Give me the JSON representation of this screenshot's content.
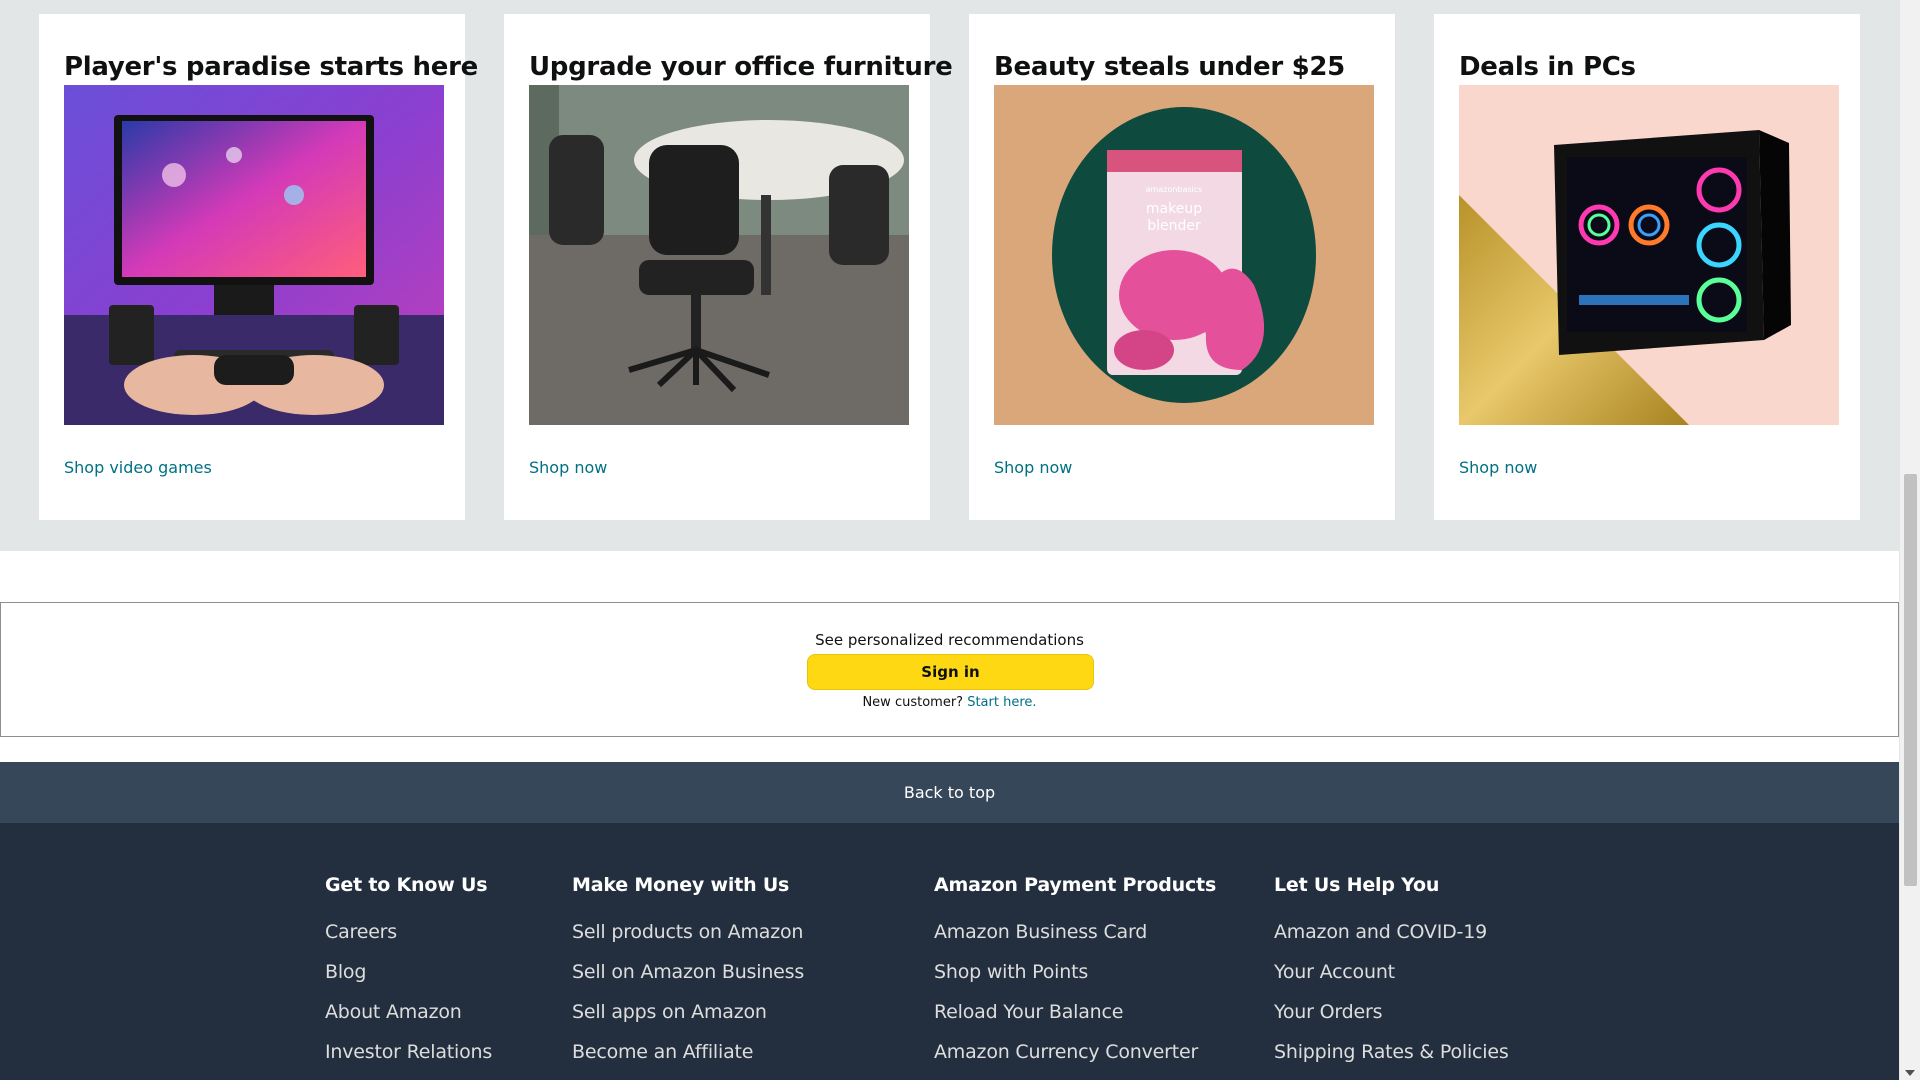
{
  "cards": [
    {
      "title": "Player's paradise starts here",
      "link": "Shop video games",
      "image": "gaming-setup-image"
    },
    {
      "title": "Upgrade your office furniture",
      "link": "Shop now",
      "image": "office-chair-image"
    },
    {
      "title": "Beauty steals under $25",
      "link": "Shop now",
      "image": "makeup-blender-image",
      "product_text": [
        "amazonbasics",
        "makeup",
        "blender"
      ]
    },
    {
      "title": "Deals in PCs",
      "link": "Shop now",
      "image": "gaming-pc-image"
    }
  ],
  "signin": {
    "prompt": "See personalized recommendations",
    "button": "Sign in",
    "new_customer": "New customer?",
    "start_here": "Start here."
  },
  "back_to_top": "Back to top",
  "footer": {
    "columns": [
      {
        "heading": "Get to Know Us",
        "links": [
          "Careers",
          "Blog",
          "About Amazon",
          "Investor Relations"
        ]
      },
      {
        "heading": "Make Money with Us",
        "links": [
          "Sell products on Amazon",
          "Sell on Amazon Business",
          "Sell apps on Amazon",
          "Become an Affiliate"
        ]
      },
      {
        "heading": "Amazon Payment Products",
        "links": [
          "Amazon Business Card",
          "Shop with Points",
          "Reload Your Balance",
          "Amazon Currency Converter"
        ]
      },
      {
        "heading": "Let Us Help You",
        "links": [
          "Amazon and COVID-19",
          "Your Account",
          "Your Orders",
          "Shipping Rates & Policies"
        ]
      }
    ]
  },
  "colors": {
    "band": "#e3e6e6",
    "link": "#007185",
    "signin_button": "#ffd814",
    "back_to_top": "#37475a",
    "footer": "#232f3e"
  }
}
